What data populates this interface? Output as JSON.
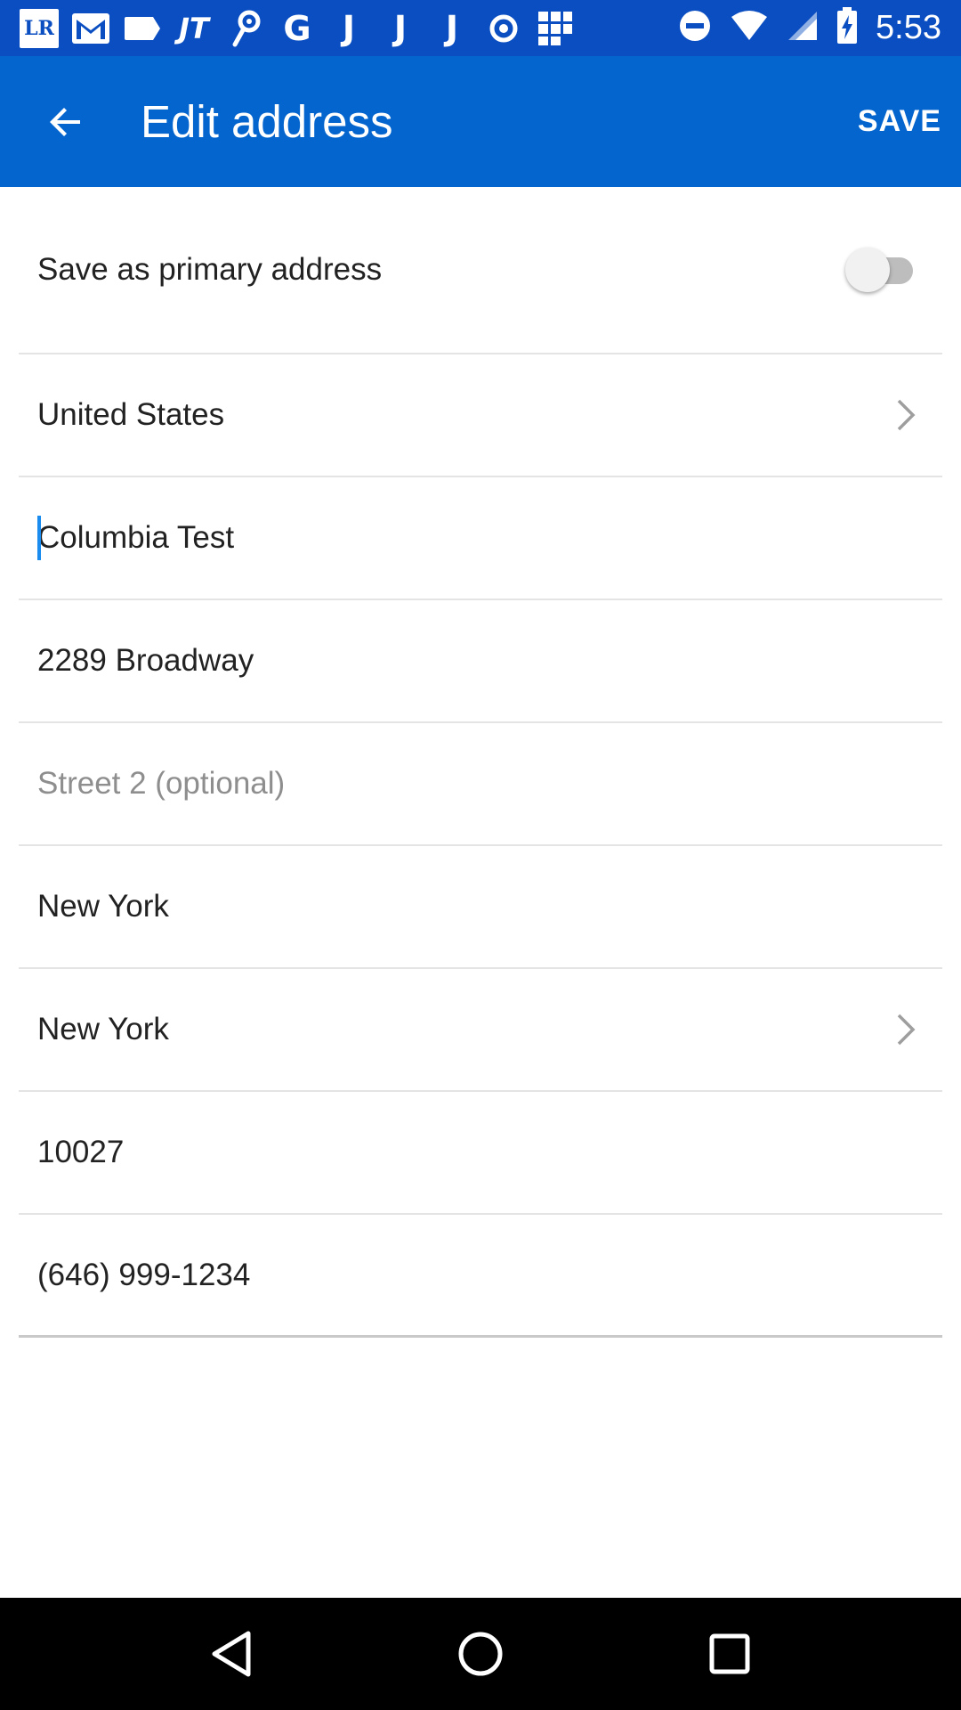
{
  "status_bar": {
    "time": "5:53",
    "notification_icons": [
      "lr-app-icon",
      "gmail-icon",
      "tag-icon",
      "jt-icon",
      "pin-icon",
      "google-icon",
      "j-icon",
      "j-icon",
      "j-icon",
      "circle-dot-icon",
      "grid-icon"
    ],
    "lr_label": "LR",
    "g_label": "G",
    "j_label": "J",
    "jt_label": "JT"
  },
  "app_bar": {
    "title": "Edit address",
    "save_label": "SAVE",
    "color": "#0465cf"
  },
  "form": {
    "primary_label": "Save as primary address",
    "primary_toggle_on": false,
    "country": "United States",
    "name": "Columbia Test",
    "street1": "2289 Broadway",
    "street2_placeholder": "Street 2 (optional)",
    "city": "New York",
    "state": "New York",
    "zip": "10027",
    "phone": "(646) 999-1234"
  },
  "nav_bar": {
    "buttons": [
      "back-icon",
      "home-icon",
      "recents-icon"
    ]
  }
}
